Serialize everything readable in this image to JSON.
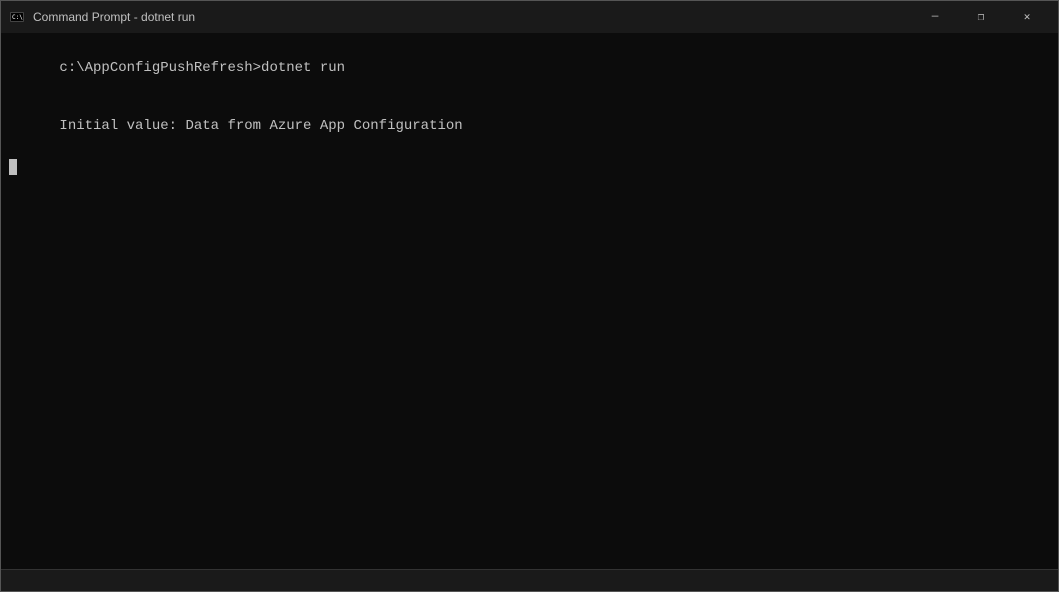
{
  "window": {
    "title": "Command Prompt - dotnet  run",
    "bg_color": "#0c0c0c"
  },
  "titlebar": {
    "title": "Command Prompt - dotnet  run",
    "minimize_label": "—",
    "maximize_label": "❐",
    "close_label": "✕"
  },
  "terminal": {
    "line1": "c:\\AppConfigPushRefresh>dotnet run",
    "line2": "Initial value: Data from Azure App Configuration",
    "statusbar_text": ""
  }
}
